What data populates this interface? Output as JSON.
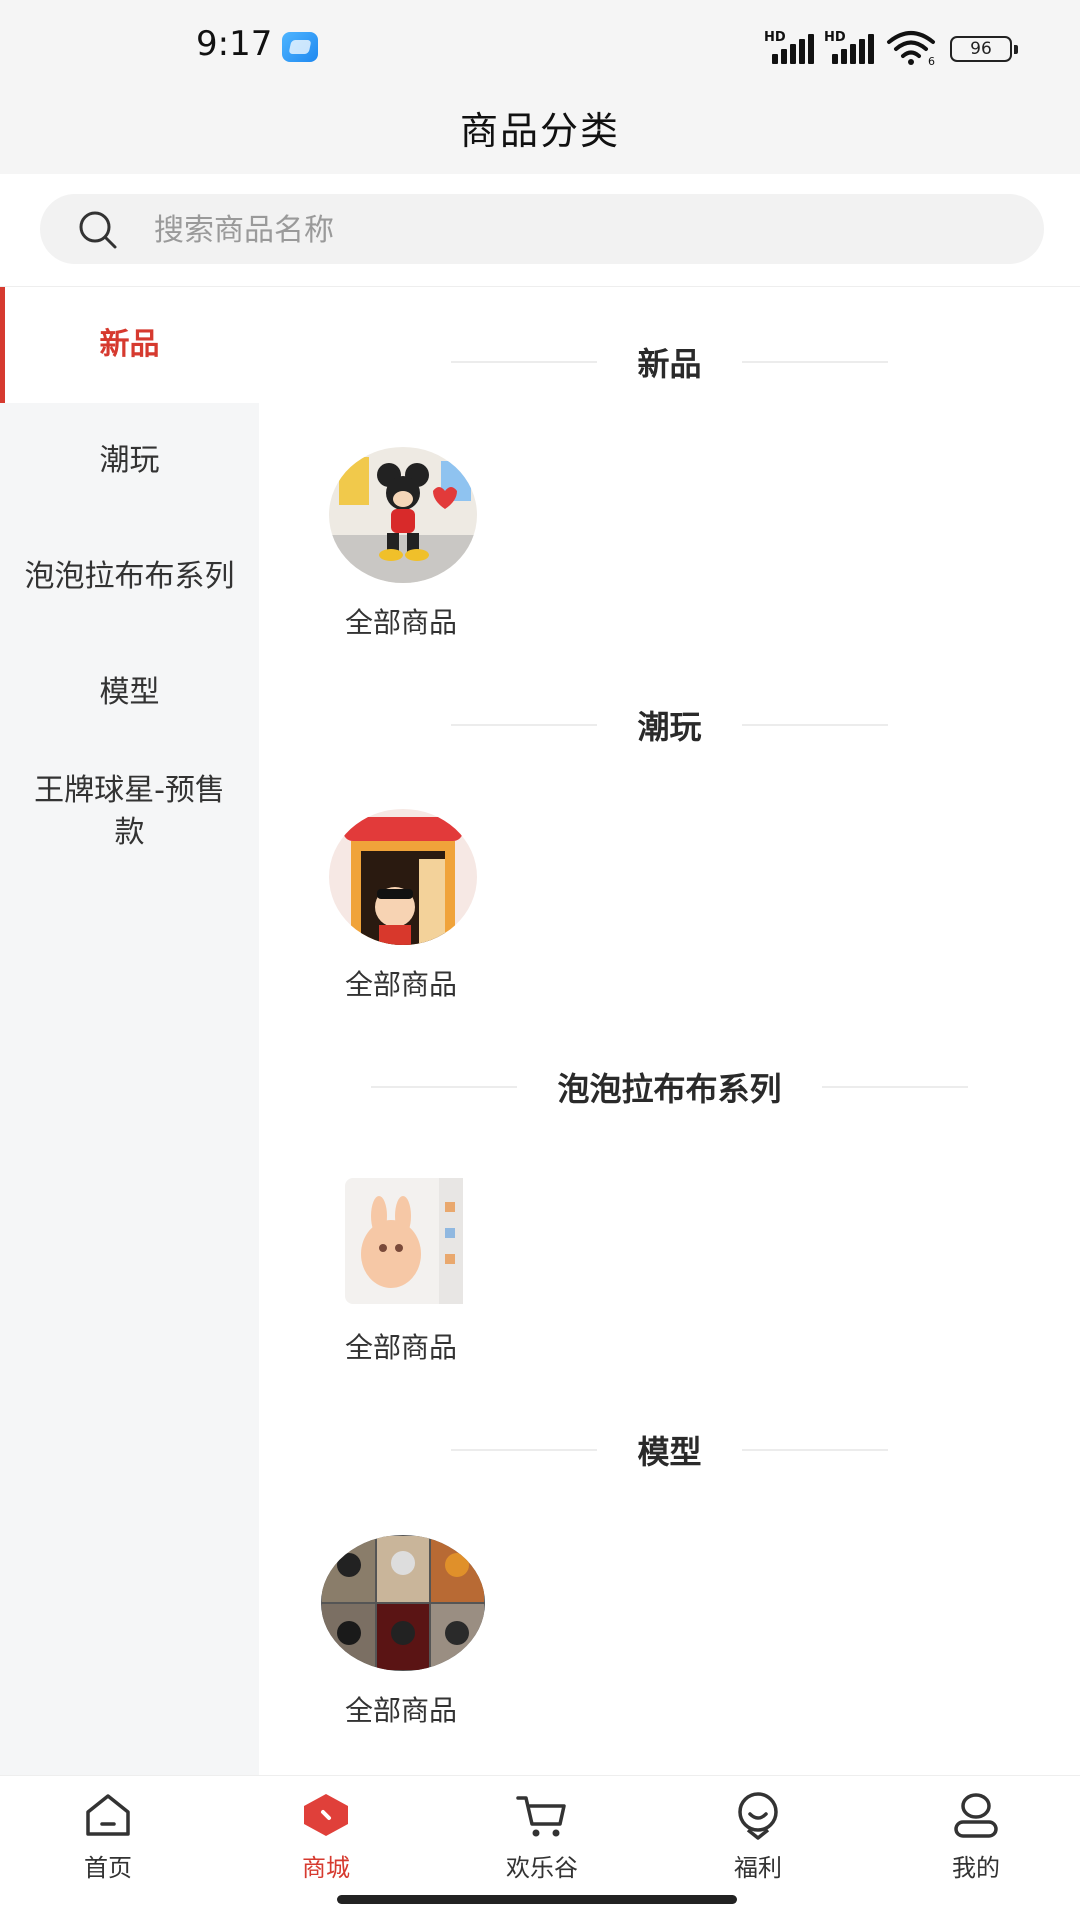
{
  "status_bar": {
    "time": "9:17",
    "signal_label_1": "HD",
    "signal_label_2": "HD",
    "wifi_label": "6",
    "battery": "96"
  },
  "header": {
    "title": "商品分类"
  },
  "search": {
    "placeholder": "搜索商品名称",
    "value": ""
  },
  "sidebar": {
    "items": [
      {
        "label": "新品",
        "active": true
      },
      {
        "label": "潮玩",
        "active": false
      },
      {
        "label": "泡泡拉布布系列",
        "active": false
      },
      {
        "label": "模型",
        "active": false
      },
      {
        "label": "王牌球星-预售款",
        "active": false
      }
    ]
  },
  "sections": [
    {
      "title": "新品",
      "item_label": "全部商品",
      "image": "mickey-figure"
    },
    {
      "title": "潮玩",
      "item_label": "全部商品",
      "image": "crayon-shin-chan-box"
    },
    {
      "title": "泡泡拉布布系列",
      "item_label": "全部商品",
      "image": "labubu-blind-box"
    },
    {
      "title": "模型",
      "item_label": "全部商品",
      "image": "naruto-figures-grid"
    }
  ],
  "tabbar": {
    "items": [
      {
        "label": "首页",
        "icon": "home-icon",
        "active": false
      },
      {
        "label": "商城",
        "icon": "mall-icon",
        "active": true
      },
      {
        "label": "欢乐谷",
        "icon": "cart-icon",
        "active": false
      },
      {
        "label": "福利",
        "icon": "gift-face-icon",
        "active": false
      },
      {
        "label": "我的",
        "icon": "profile-icon",
        "active": false
      }
    ]
  },
  "colors": {
    "accent": "#d63a2f",
    "sidebar_bg": "#f5f6f7",
    "header_bg": "#f5f5f5"
  }
}
